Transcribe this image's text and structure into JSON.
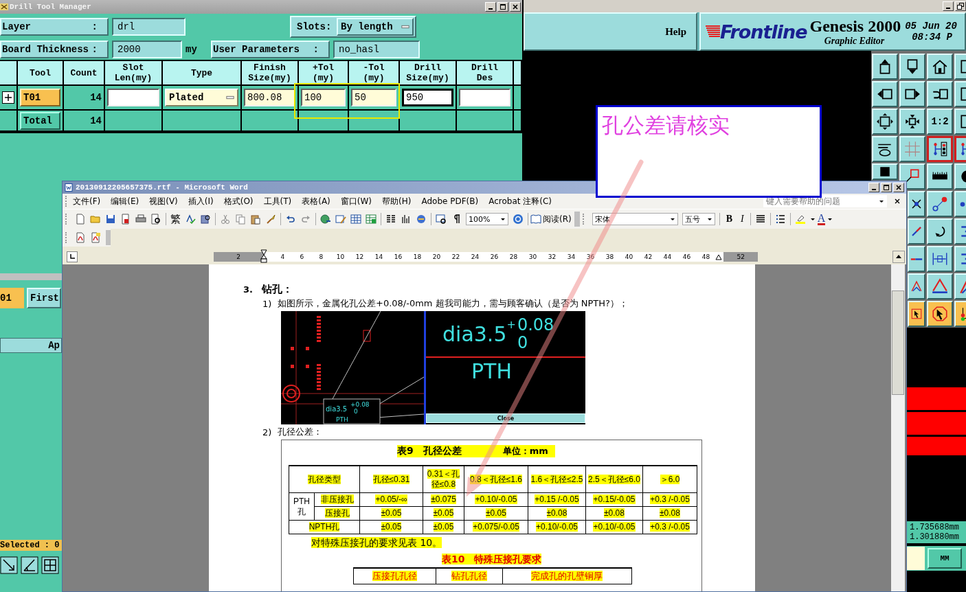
{
  "drill_tool_manager": {
    "title": "Drill Tool Manager",
    "layer": {
      "label": "Layer",
      "colon": ":",
      "value": "drl"
    },
    "slots": {
      "label": "Slots:",
      "value": "By length"
    },
    "board_thickness": {
      "label": "Board Thickness",
      "colon": ":",
      "value": "2000",
      "unit": "my"
    },
    "user_parameters": {
      "label": "User Parameters",
      "colon": ":",
      "value": "no_hasl"
    },
    "columns": [
      "Tool",
      "Count",
      "Slot Len(my)",
      "Type",
      "Finish Size(my)",
      "+Tol (my)",
      "-Tol (my)",
      "Drill Size(my)",
      "Drill Des"
    ],
    "tool_row": {
      "expanded": false,
      "tool": "T01",
      "count": "14",
      "type": "Plated",
      "finish_size": "800.08",
      "plus_tol": "100",
      "minus_tol": "50",
      "drill_size": "950"
    },
    "total_row": {
      "label": "Total",
      "count": "14"
    },
    "lower": {
      "tool": "01",
      "first_button": "First",
      "apply_button": "Ap",
      "selected_status": "Selected : 0"
    }
  },
  "genesis": {
    "help": "Help",
    "logo": "Frontline",
    "product": "Genesis 2000",
    "subtitle": "Graphic Editor",
    "date": "05 Jun 20",
    "time": "08:34 P",
    "scale_button": "1:2",
    "coord_x": "1.735688mm",
    "coord_y": "1.301880mm",
    "unit_button": "MM"
  },
  "comment": {
    "text": "孔公差请核实"
  },
  "word": {
    "title": "20130912205657375.rtf - Microsoft Word",
    "menu": [
      "文件(F)",
      "编辑(E)",
      "视图(V)",
      "插入(I)",
      "格式(O)",
      "工具(T)",
      "表格(A)",
      "窗口(W)",
      "帮助(H)",
      "Adobe PDF(B)",
      "Acrobat 注释(C)"
    ],
    "help_placeholder": "键入需要帮助的问题",
    "traditional": "繁",
    "zoom": "100%",
    "read": "阅读(R)",
    "font": "宋体",
    "font_size": "五号",
    "bold": "B",
    "italic": "I",
    "font_color": "A",
    "ruler": [
      "2",
      "4",
      "6",
      "8",
      "10",
      "12",
      "14",
      "16",
      "18",
      "20",
      "22",
      "24",
      "26",
      "28",
      "30",
      "32",
      "34",
      "36",
      "38",
      "40",
      "42",
      "44",
      "46",
      "48",
      "52"
    ],
    "doc": {
      "section_number": "3.",
      "section_title": "钻孔：",
      "items": [
        {
          "number": "1)",
          "text": "如图所示，金属化孔公差+0.08/-0mm 超我司能力，需与顾客确认（是否为 NPTH?）；"
        },
        {
          "number": "2)",
          "text": "孔径公差："
        }
      ],
      "figure": {
        "big_label": "dia3.5",
        "tol_plus": "+",
        "tol_upper": "0.08",
        "tol_lower": "0",
        "type_label": "PTH",
        "close_button": "Close",
        "small_label": "dia3.5",
        "small_tol_upper": "+0.08",
        "small_tol_lower": "0",
        "small_type": "PTH"
      },
      "table9": {
        "caption": "表9　孔径公差",
        "unit": "单位：mm",
        "headers": [
          "孔径类型",
          "孔径≤0.31",
          "0.31＜孔径≤0.8",
          "0.8＜孔径≤1.6",
          "1.6＜孔径≤2.5",
          "2.5＜孔径≤6.0",
          "＞6.0"
        ],
        "groups": [
          {
            "name": "PTH 孔",
            "rows": [
              {
                "name": "非压接孔",
                "values": [
                  "+0.05/-∞",
                  "±0.075",
                  "+0.10/-0.05",
                  "+0.15 /-0.05",
                  "+0.15/-0.05",
                  "+0.3 /-0.05"
                ]
              },
              {
                "name": "压接孔",
                "values": [
                  "±0.05",
                  "±0.05",
                  "±0.05",
                  "±0.08",
                  "±0.08",
                  "±0.08"
                ]
              }
            ]
          },
          {
            "name": "NPTH孔",
            "rows": [
              {
                "values": [
                  "±0.05",
                  "±0.05",
                  "+0.075/-0.05",
                  "+0.10/-0.05",
                  "+0.10/-0.05",
                  "+0.3 /-0.05"
                ]
              }
            ]
          }
        ]
      },
      "note": "对特殊压接孔的要求见表 10。",
      "table10": {
        "caption": "表10　特殊压接孔要求",
        "headers": [
          "压接孔孔径",
          "钻孔孔径",
          "完成孔的孔壁铜厚"
        ]
      }
    }
  }
}
